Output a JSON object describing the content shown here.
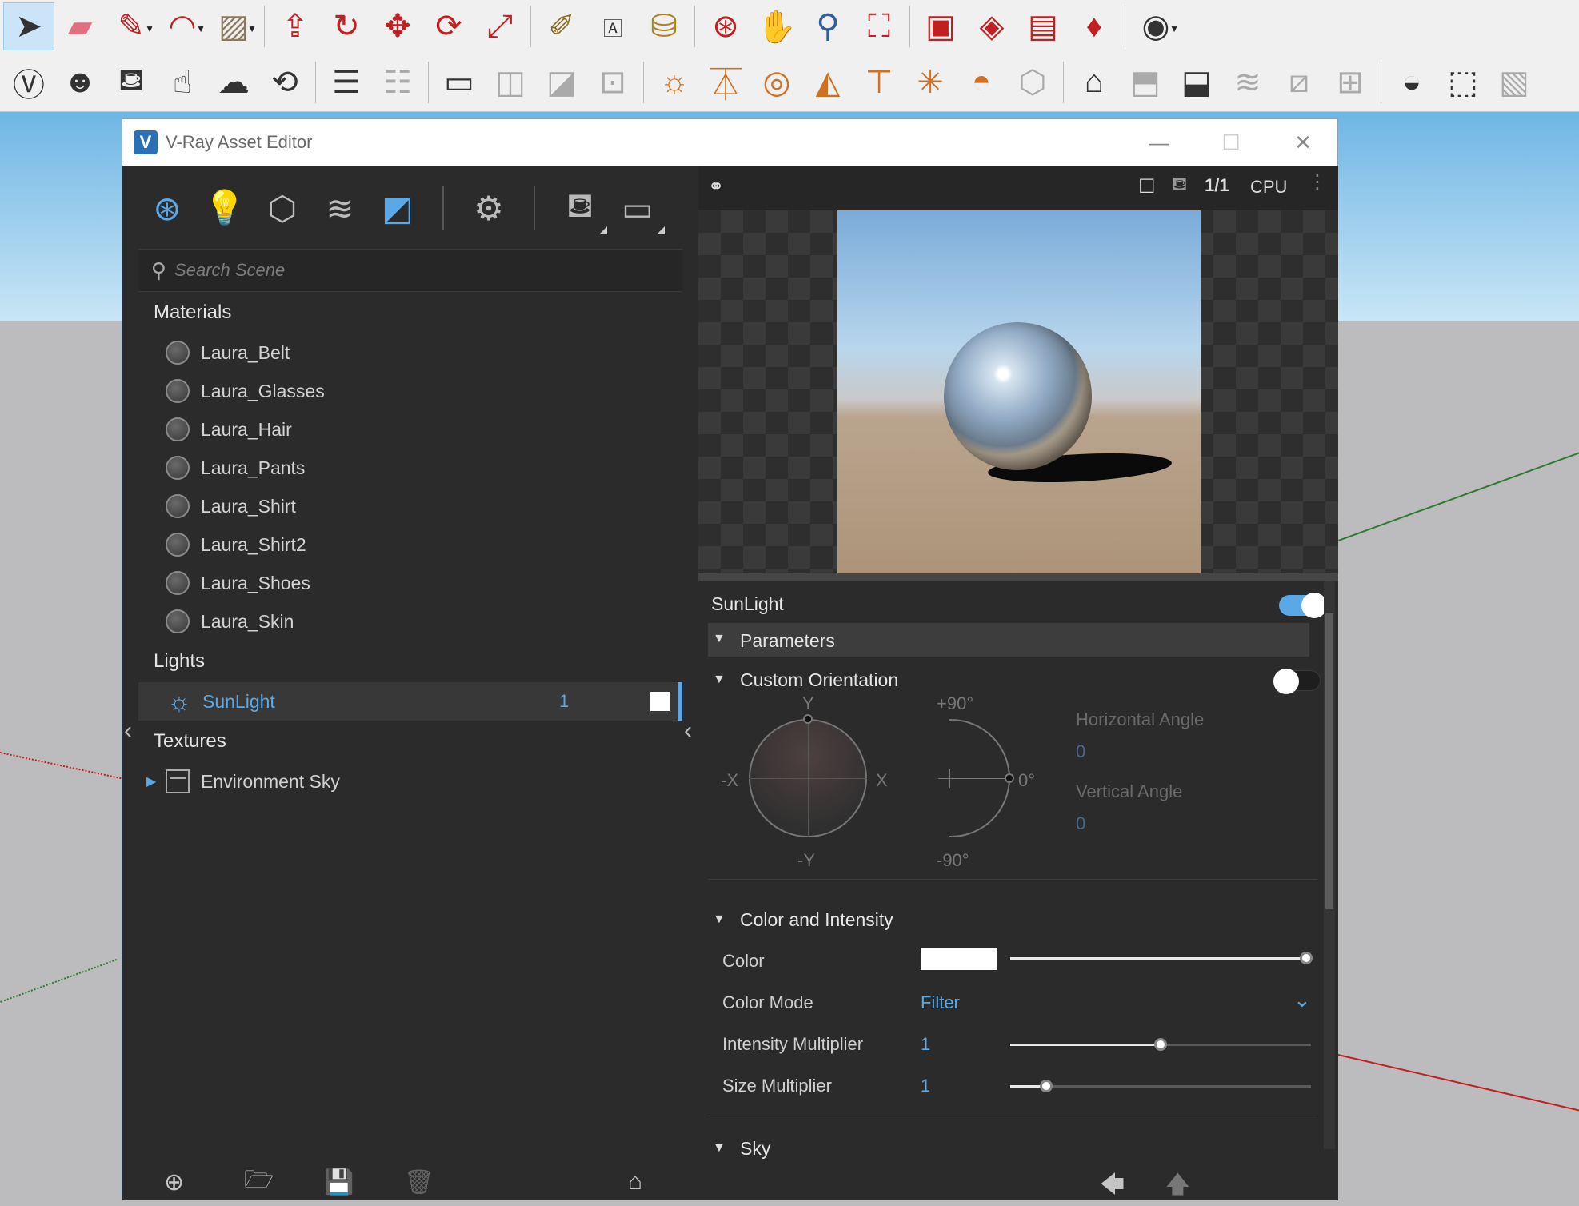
{
  "toolbar1": [
    "select",
    "eraser",
    "pencil",
    "arc",
    "shape",
    "push-pull",
    "follow-me",
    "move",
    "rotate",
    "scale",
    "tape-measure",
    "text",
    "paint",
    "orbit",
    "pan",
    "zoom",
    "zoom-extents",
    "ruby-1",
    "ruby-2",
    "ruby-3",
    "ruby-gem",
    "user"
  ],
  "window": {
    "title": "V-Ray Asset Editor"
  },
  "search": {
    "placeholder": "Search Scene"
  },
  "materials": {
    "heading": "Materials",
    "items": [
      "Laura_Belt",
      "Laura_Glasses",
      "Laura_Hair",
      "Laura_Pants",
      "Laura_Shirt",
      "Laura_Shirt2",
      "Laura_Shoes",
      "Laura_Skin"
    ]
  },
  "lights": {
    "heading": "Lights",
    "items": [
      {
        "name": "SunLight",
        "count": "1"
      }
    ]
  },
  "textures": {
    "heading": "Textures",
    "items": [
      "Environment Sky"
    ]
  },
  "preview": {
    "ratio": "1/1",
    "engine": "CPU"
  },
  "asset": {
    "name": "SunLight",
    "enabled": true
  },
  "parameters": {
    "heading": "Parameters"
  },
  "orientation": {
    "heading": "Custom Orientation",
    "enabled": false,
    "y": "Y",
    "neg_x": "-X",
    "x": "X",
    "neg_y": "-Y",
    "plus90": "+90°",
    "zero": "0°",
    "minus90": "-90°",
    "h_label": "Horizontal Angle",
    "h_value": "0",
    "v_label": "Vertical Angle",
    "v_value": "0"
  },
  "color_intensity": {
    "heading": "Color and Intensity",
    "color_label": "Color",
    "color_value": "#ffffff",
    "color_level": 1.0,
    "mode_label": "Color Mode",
    "mode_value": "Filter",
    "intensity_label": "Intensity Multiplier",
    "intensity_value": "1",
    "intensity_level": 0.5,
    "size_label": "Size Multiplier",
    "size_value": "1",
    "size_level": 0.12
  },
  "sky": {
    "heading": "Sky"
  },
  "colors": {
    "accent": "#5aa8e6",
    "panel": "#2b2b2b"
  }
}
